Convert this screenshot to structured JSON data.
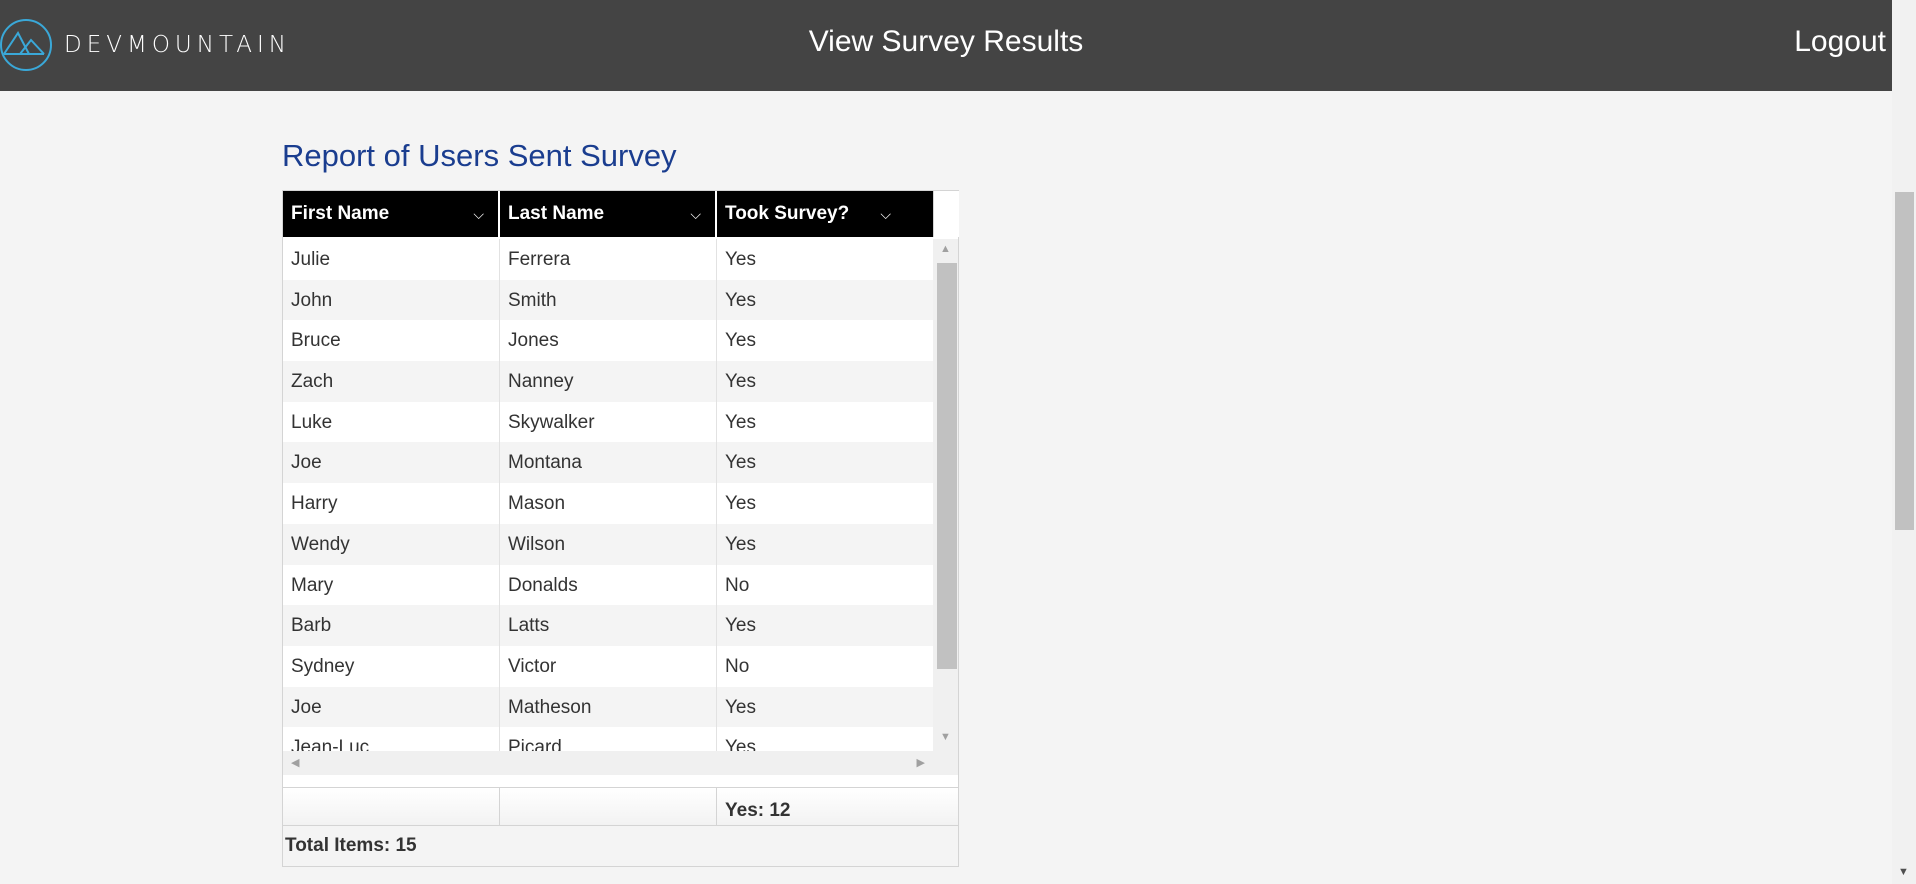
{
  "header": {
    "logo_text": "DEVMOUNTAIN",
    "page_title": "View Survey Results",
    "logout_label": "Logout"
  },
  "report": {
    "title": "Report of Users Sent Survey",
    "columns": [
      "First Name",
      "Last Name",
      "Took Survey?"
    ],
    "rows": [
      {
        "first": "Julie",
        "last": "Ferrera",
        "took": "Yes"
      },
      {
        "first": "John",
        "last": "Smith",
        "took": "Yes"
      },
      {
        "first": "Bruce",
        "last": "Jones",
        "took": "Yes"
      },
      {
        "first": "Zach",
        "last": "Nanney",
        "took": "Yes"
      },
      {
        "first": "Luke",
        "last": "Skywalker",
        "took": "Yes"
      },
      {
        "first": "Joe",
        "last": "Montana",
        "took": "Yes"
      },
      {
        "first": "Harry",
        "last": "Mason",
        "took": "Yes"
      },
      {
        "first": "Wendy",
        "last": "Wilson",
        "took": "Yes"
      },
      {
        "first": "Mary",
        "last": "Donalds",
        "took": "No"
      },
      {
        "first": "Barb",
        "last": "Latts",
        "took": "Yes"
      },
      {
        "first": "Sydney",
        "last": "Victor",
        "took": "No"
      },
      {
        "first": "Joe",
        "last": "Matheson",
        "took": "Yes"
      },
      {
        "first": "Jean-Luc",
        "last": "Picard",
        "took": "Yes"
      }
    ],
    "aggregate": "Yes: 12",
    "total_items": "Total Items: 15"
  },
  "colors": {
    "topbar": "#444444",
    "title_blue": "#1a3d8f",
    "logo_circle": "#3aa8d8"
  },
  "icons": {
    "logo": "mountain-circle-icon",
    "column_menu": "chevron-down-icon"
  }
}
